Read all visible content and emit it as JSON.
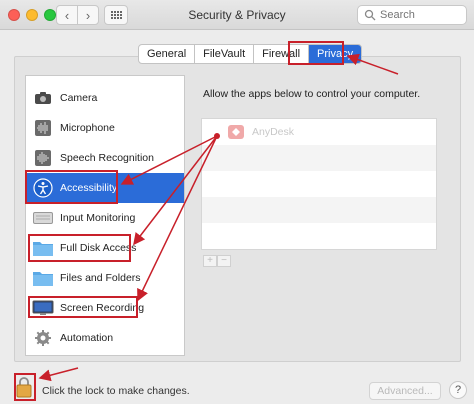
{
  "window": {
    "title": "Security & Privacy"
  },
  "toolbar": {
    "back_glyph": "‹",
    "forward_glyph": "›"
  },
  "search": {
    "placeholder": "Search"
  },
  "tabs": [
    {
      "label": "General"
    },
    {
      "label": "FileVault"
    },
    {
      "label": "Firewall"
    },
    {
      "label": "Privacy",
      "active": true
    }
  ],
  "sidebar": {
    "items": [
      {
        "label": "Camera",
        "icon": "camera-icon"
      },
      {
        "label": "Microphone",
        "icon": "microphone-icon"
      },
      {
        "label": "Speech Recognition",
        "icon": "speech-recognition-icon"
      },
      {
        "label": "Accessibility",
        "icon": "accessibility-icon",
        "active": true
      },
      {
        "label": "Input Monitoring",
        "icon": "keyboard-icon"
      },
      {
        "label": "Full Disk Access",
        "icon": "folder-icon"
      },
      {
        "label": "Files and Folders",
        "icon": "folder-icon"
      },
      {
        "label": "Screen Recording",
        "icon": "display-icon"
      },
      {
        "label": "Automation",
        "icon": "gear-icon"
      }
    ]
  },
  "main": {
    "caption": "Allow the apps below to control your computer.",
    "apps": [
      {
        "name": "AnyDesk",
        "icon": "anydesk-icon"
      }
    ],
    "add_glyph": "+",
    "remove_glyph": "−"
  },
  "footer": {
    "lock_text": "Click the lock to make changes.",
    "advanced_label": "Advanced...",
    "help_glyph": "?"
  },
  "colors": {
    "selection_blue": "#2b6cd8",
    "annotation_red": "#c8202a",
    "anydesk_red": "#f0a9a9"
  }
}
